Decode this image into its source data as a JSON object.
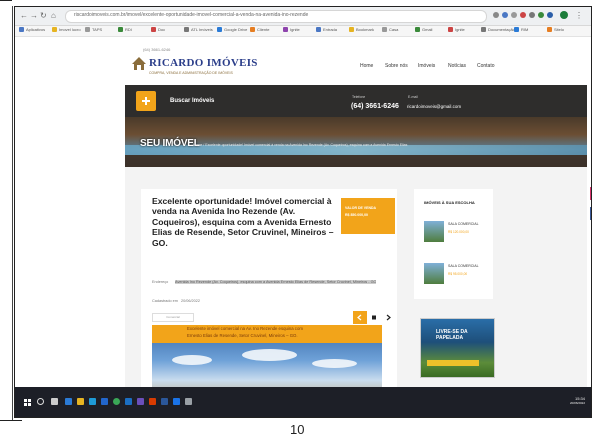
{
  "browser": {
    "url": "riscardoimoveis.com.br/imovel/excelente-oportunidade-imovel-comercial-a-venda-na-avenida-ino-rezende",
    "bookmarks": [
      "Aplicativos",
      "Imovel lucro",
      "TAPS",
      "RDI",
      "Doc",
      "ATL Imóveis",
      "Google Drive",
      "Cliente",
      "Ignite",
      "Entrada",
      "Bookmark",
      "Casa",
      "Gmail",
      "Ignite",
      "Documentação",
      "RIM",
      "Sitelo"
    ]
  },
  "site": {
    "phone_small": "(64) 3661-6246",
    "logo_text": "RICARDO IMÓVEIS",
    "logo_sub": "COMPRA, VENDA E ADMINISTRAÇÃO DE IMÓVEIS",
    "menu": [
      "Home",
      "Sobre nós",
      "Imóveis",
      "Notícias",
      "Contato"
    ],
    "search_label": "Buscar Imóveis",
    "phone_label": "Telefone",
    "phone_big": "(64) 3661-6246",
    "email_label": "E-mail",
    "email": "ricardoimoveis@gmail.com",
    "hero_title": "SEU IMÓVEL",
    "hero_breadcrumb": "Home / Excelente oportunidade! Imóvel comercial à venda na Avenida Ino Rezende (Av. Coqueiros), esquina com a Avenida Ernesto Elias"
  },
  "listing": {
    "title": "Excelente oportunidade! Imóvel comercial à venda na Avenida Ino Rezende (Av. Coqueiros), esquina com a Avenida Ernesto Elias de Resende, Setor Cruvinel, Mineiros – GO.",
    "price_label": "VALOR DE VENDA",
    "price_value": "R$ 850.000,00",
    "address_label": "Endereço",
    "address": "Avenida Ino Rezende (Av. Coqueiros), esquina com a Avenida Ernesto Elias de Resende, Setor Cruvinel, Mineiros - GO",
    "code_label": "Cadastrado em",
    "code": "20/06/2022",
    "tag": "Comercial",
    "photo_caption_1": "Excelente imóvel comercial na Av. Ino Rezende esquina com",
    "photo_caption_2": "Ernesto Elias de Resende, Setor Cruvinel, Mineiros – GO."
  },
  "sidebar": {
    "title": "IMÓVEIS À SUA ESCOLHA",
    "items": [
      {
        "name": "SALA COMERCIAL",
        "price": "R$ 120.000,00"
      },
      {
        "name": "SALA COMERCIAL",
        "price": "R$ 95.000,00"
      }
    ],
    "ad_text": "LIVRE-SE DA PAPELADA"
  },
  "taskbar": {
    "time": "15:34",
    "date": "20/06/2022"
  },
  "page_number": "10",
  "colors": {
    "accent": "#f2a41a",
    "dark": "#2e2d2c",
    "logo": "#2b3e8a"
  }
}
